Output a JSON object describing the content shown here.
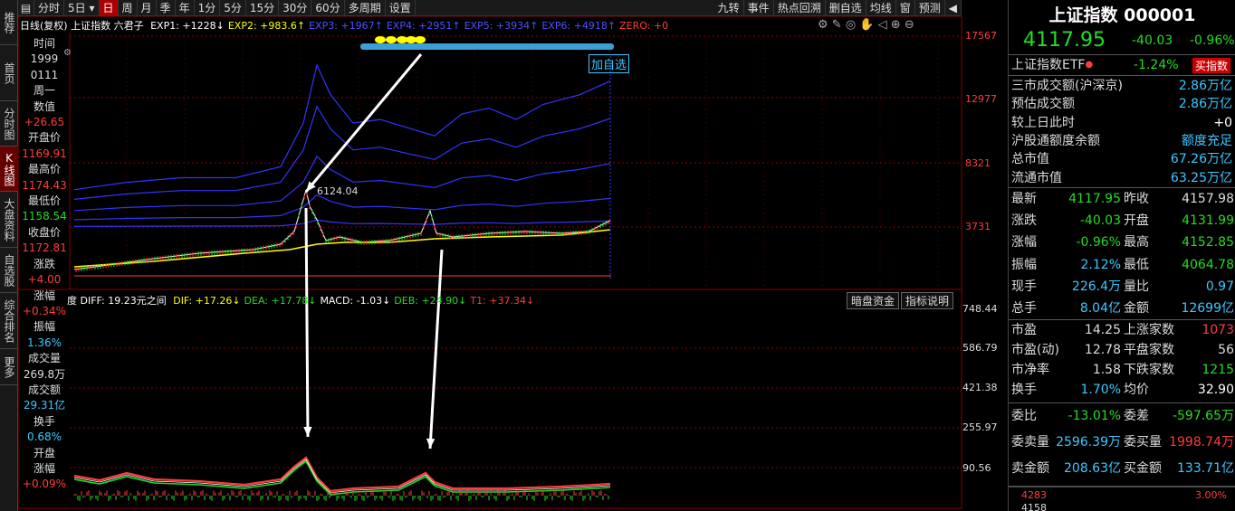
{
  "left_tabs": [
    "推荐",
    "首页",
    "分时图",
    "K线图",
    "大盘资料",
    "自选股",
    "综合排名",
    "更多"
  ],
  "left_tab_active": 3,
  "toolbar": {
    "periods": [
      "分时",
      "5日",
      "日",
      "周",
      "月",
      "季",
      "年",
      "1分",
      "5分",
      "15分",
      "30分",
      "60分",
      "多周期",
      "设置"
    ],
    "active": "日",
    "right": [
      "九转",
      "事件",
      "热点回溯",
      "删自选",
      "均线",
      "窗",
      "预测"
    ]
  },
  "legend": {
    "title": "日线(复权)",
    "index": "上证指数",
    "indicator": "六君子",
    "items": [
      {
        "name": "EXP1:",
        "value": "+1228",
        "arrow": "↓",
        "color": "#ffffff"
      },
      {
        "name": "EXP2:",
        "value": "+983.6",
        "arrow": "↑",
        "color": "#ffff00"
      },
      {
        "name": "EXP3:",
        "value": "+1967",
        "arrow": "↑",
        "color": "#5050ff"
      },
      {
        "name": "EXP4:",
        "value": "+2951",
        "arrow": "↑",
        "color": "#5050ff"
      },
      {
        "name": "EXP5:",
        "value": "+3934",
        "arrow": "↑",
        "color": "#5050ff"
      },
      {
        "name": "EXP6:",
        "value": "+4918",
        "arrow": "↑",
        "color": "#5050ff"
      },
      {
        "name": "ZERO:",
        "value": "+0",
        "arrow": "",
        "color": "#ff3c3c"
      }
    ]
  },
  "main_axis_ticks": [
    "17567",
    "12977",
    "8321",
    "3731"
  ],
  "macd_axis_ticks": [
    "748.44",
    "586.79",
    "421.38",
    "255.97",
    "90.56"
  ],
  "peak_label": "6124.04",
  "add_watch": "加自选",
  "info": {
    "time_label": "时间",
    "time_year": "1999",
    "time_date": "0111",
    "weekday": "周一",
    "value_label": "数值",
    "value": "+26.65",
    "open_label": "开盘价",
    "open": "1169.91",
    "high_label": "最高价",
    "high": "1174.43",
    "low_label": "最低价",
    "low": "1158.54",
    "close_label": "收盘价",
    "close": "1172.81",
    "chg_label": "涨跌",
    "chg": "+4.00",
    "pct_label": "涨幅",
    "pct": "+0.34%",
    "amp_label": "振幅",
    "amp": "1.36%",
    "vol_label": "成交量",
    "vol": "269.8万",
    "amt_label": "成交额",
    "amt": "29.31亿",
    "turn_label": "换手",
    "turn": "0.68%",
    "open_pct_label1": "开盘",
    "open_pct_label2": "涨幅",
    "open_pct": "+0.09%"
  },
  "macd_legend": {
    "prefix": "度 DIFF: 19.23元之间",
    "items": [
      {
        "name": "DIF:",
        "value": "+17.26",
        "arrow": "↓",
        "color": "#ffff00"
      },
      {
        "name": "DEA:",
        "value": "+17.78",
        "arrow": "↓",
        "color": "#22dd22"
      },
      {
        "name": "MACD:",
        "value": "-1.03",
        "arrow": "↓",
        "color": "#ffffff"
      },
      {
        "name": "DEB:",
        "value": "+24.90",
        "arrow": "↓",
        "color": "#22dd22"
      },
      {
        "name": "T1:",
        "value": "+37.34",
        "arrow": "↓",
        "color": "#ff3c3c"
      }
    ],
    "buttons": [
      "暗盘资金",
      "指标说明"
    ]
  },
  "quote": {
    "title": "上证指数 000001",
    "price": "4117.95",
    "change": "-40.03",
    "change_pct": "-0.96%",
    "etf_label": "上证指数ETF",
    "etf_pct": "-1.24%",
    "buy_btn": "买指数",
    "stats": [
      {
        "label": "三市成交额(沪深京)",
        "value": "2.86万亿"
      },
      {
        "label": "预估成交额",
        "value": "2.86万亿"
      },
      {
        "label": "较上日此时",
        "value": "+0"
      },
      {
        "label": "沪股通额度余额",
        "value": "额度充足"
      },
      {
        "label": "总市值",
        "value": "67.26万亿"
      },
      {
        "label": "流通市值",
        "value": "63.25万亿"
      }
    ],
    "grid": [
      [
        "最新",
        "4117.95",
        "昨收",
        "4157.98"
      ],
      [
        "涨跌",
        "-40.03",
        "开盘",
        "4131.99"
      ],
      [
        "涨幅",
        "-0.96%",
        "最高",
        "4152.85"
      ],
      [
        "振幅",
        "2.12%",
        "最低",
        "4064.78"
      ],
      [
        "现手",
        "226.4万",
        "量比",
        "0.97"
      ],
      [
        "总手",
        "8.04亿",
        "金额",
        "12699亿"
      ]
    ],
    "grid2": [
      [
        "市盈",
        "14.25",
        "上涨家数",
        "1073"
      ],
      [
        "市盈(动)",
        "12.78",
        "平盘家数",
        "56"
      ],
      [
        "市净率",
        "1.58",
        "下跌家数",
        "1215"
      ],
      [
        "换手",
        "1.70%",
        "均价",
        "32.90"
      ]
    ],
    "orders": [
      [
        "委比",
        "-13.01%",
        "委差",
        "-597.65万"
      ],
      [
        "委卖量",
        "2596.39万",
        "委买量",
        "1998.74万"
      ],
      [
        "卖金额",
        "208.63亿",
        "买金额",
        "133.71亿"
      ]
    ],
    "mini_left": "4283",
    "mini_left2": "4158",
    "mini_right": "3.00%"
  }
}
